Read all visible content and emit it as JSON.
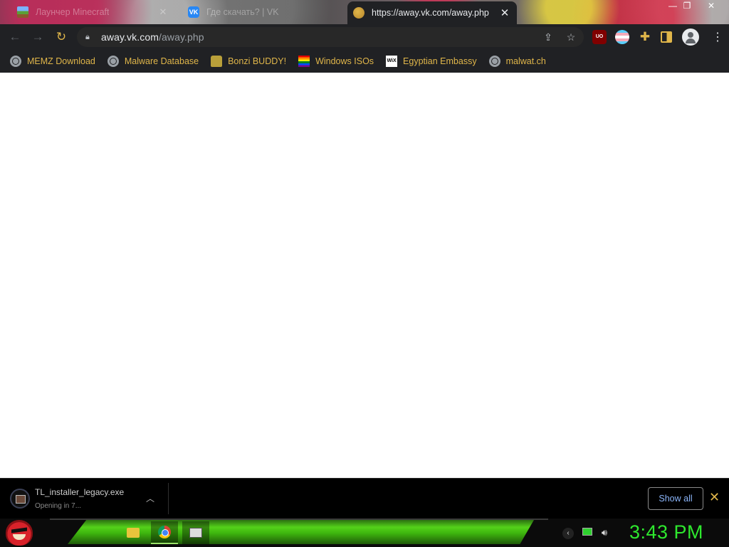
{
  "tabs": [
    {
      "title": "Лаунчер Minecraft",
      "favicon": "minecraft-icon",
      "active": false
    },
    {
      "title": "Где скачать? | VK",
      "favicon": "vk-icon",
      "active": false
    },
    {
      "title": "https://away.vk.com/away.php",
      "favicon": "globe-icon",
      "active": true
    }
  ],
  "toolbar": {
    "url_host": "away.vk.com",
    "url_path": "/away.php"
  },
  "extensions": {
    "ublock_label": "UO"
  },
  "bookmarks": [
    {
      "label": "MEMZ Download",
      "icon": "globe-icon"
    },
    {
      "label": "Malware Database",
      "icon": "globe-icon"
    },
    {
      "label": "Bonzi BUDDY!",
      "icon": "bonzi-icon"
    },
    {
      "label": "Windows ISOs",
      "icon": "rainbow-flag-icon"
    },
    {
      "label": "Egyptian Embassy",
      "icon": "wix-icon"
    },
    {
      "label": "malwat.ch",
      "icon": "globe-icon"
    }
  ],
  "download": {
    "filename": "TL_installer_legacy.exe",
    "status": "Opening in 7...",
    "show_all_label": "Show all"
  },
  "taskbar": {
    "clock": "3:43 PM"
  },
  "colors": {
    "accent": "#e0b64a",
    "clock": "#2ee82e",
    "link_blue": "#8ab4f8"
  }
}
